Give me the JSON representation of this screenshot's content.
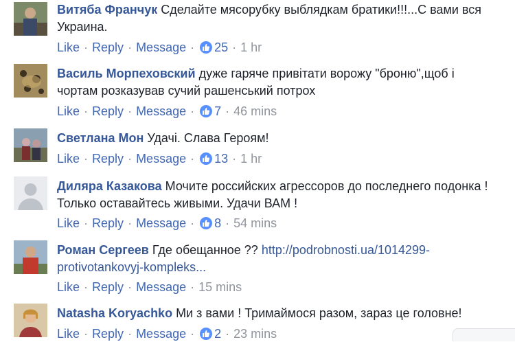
{
  "actions": {
    "like": "Like",
    "reply": "Reply",
    "message": "Message",
    "dot": "·"
  },
  "comments": [
    {
      "author": "Витяба Франчук",
      "text": "Сделайте мясорубку выблядкам братики!!!...С вами вся Украина.",
      "likes": "25",
      "time": "1 hr"
    },
    {
      "author": "Василь Морпеховский",
      "text": "дуже гаряче привітати ворожу \"броню\",щоб і чортам розказував сучий рашенський потрох",
      "likes": "7",
      "time": "46 mins"
    },
    {
      "author": "Светлана Мон",
      "text": "Удачі. Слава Героям!",
      "likes": "13",
      "time": "1 hr"
    },
    {
      "author": "Диляра Казакова",
      "text": "Мочите российских агрессоров до последнего подонка ! Только оставайтесь живыми. Удачи ВАМ !",
      "likes": "8",
      "time": "54 mins"
    },
    {
      "author": "Роман Сергеев",
      "text": "Где обещанное ??",
      "link": "http://podrobnosti.ua/1014299-protivotankovyj-kompleks...",
      "time": "15 mins"
    },
    {
      "author": "Natasha Koryachko",
      "text": "Ми з вами ! Тримаймося разом, зараз це головне!",
      "likes": "2",
      "time": "23 mins"
    }
  ],
  "colors": {
    "name": "#365899",
    "action": "#4267b2",
    "meta": "#90949c",
    "like_badge": "#5890ff"
  }
}
